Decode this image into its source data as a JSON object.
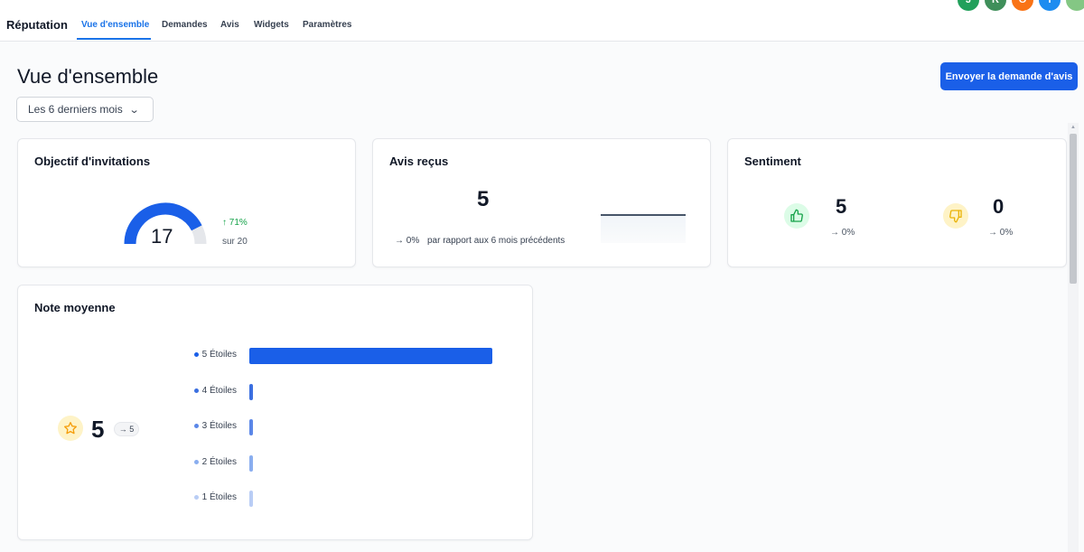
{
  "nav": {
    "brand": "Réputation",
    "tabs": [
      {
        "label": "Vue d'ensemble",
        "active": true
      },
      {
        "label": "Demandes",
        "active": false
      },
      {
        "label": "Avis",
        "active": false
      },
      {
        "label": "Widgets",
        "active": false
      },
      {
        "label": "Paramètres",
        "active": false
      }
    ],
    "avatars": [
      {
        "initial": "J",
        "color": "#22a05b"
      },
      {
        "initial": "R",
        "color": "#3f8f5a"
      },
      {
        "initial": "O",
        "color": "#f97316"
      },
      {
        "initial": "I",
        "color": "#1d8cf0"
      },
      {
        "initial": "",
        "color": "#84c784"
      }
    ]
  },
  "page": {
    "title": "Vue d'ensemble",
    "period": "Les 6 derniers mois",
    "send_button": "Envoyer la demande d'avis"
  },
  "invitations": {
    "title": "Objectif d'invitations",
    "value": "17",
    "delta": "↑ 71%",
    "goal_text": "sur 20",
    "progress": 0.85,
    "accent": "#1a5fe8"
  },
  "avis": {
    "title": "Avis reçus",
    "value": "5",
    "delta": "→ 0%",
    "comparison": "par rapport aux 6 mois précédents"
  },
  "sentiment": {
    "title": "Sentiment",
    "positive": {
      "value": "5",
      "delta": "→ 0%",
      "icon": "thumbs-up-icon",
      "color": "#16a34a"
    },
    "negative": {
      "value": "0",
      "delta": "→ 0%",
      "icon": "thumbs-down-icon",
      "color": "#eab308"
    }
  },
  "rating": {
    "title": "Note moyenne",
    "value": "5",
    "badge": "→ 5",
    "icon": "star-icon"
  },
  "chart_data": {
    "type": "bar",
    "categories": [
      "5 Étoiles",
      "4 Étoiles",
      "3 Étoiles",
      "2 Étoiles",
      "1 Étoiles"
    ],
    "values": [
      5,
      0,
      0,
      0,
      0
    ],
    "colors": [
      "#1a5fe8",
      "#3b6fe0",
      "#5b87e8",
      "#8aaeef",
      "#b9cdf5"
    ]
  }
}
